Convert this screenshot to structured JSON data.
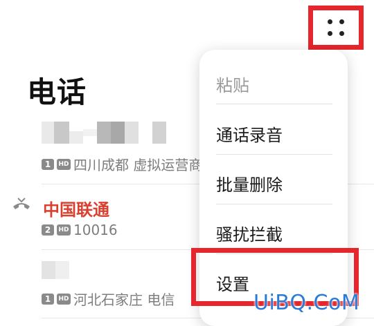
{
  "page": {
    "title": "电话"
  },
  "more_button": {
    "icon": "more-dots-icon"
  },
  "calls": [
    {
      "sim": "1",
      "hd": "HD",
      "location": "四川成都 虚拟运营商",
      "name_obscured": true
    },
    {
      "name": "中国联通",
      "sim": "2",
      "hd": "HD",
      "number": "10016",
      "status_icon": "missed-call-icon",
      "name_color": "#d8402f"
    },
    {
      "sim": "1",
      "hd": "HD",
      "location": "河北石家庄 电信",
      "name_obscured": true
    }
  ],
  "menu": {
    "items": [
      {
        "label": "粘贴",
        "enabled": false
      },
      {
        "label": "通话录音",
        "enabled": true
      },
      {
        "label": "批量删除",
        "enabled": true
      },
      {
        "label": "骚扰拦截",
        "enabled": true
      },
      {
        "label": "设置",
        "enabled": true
      }
    ]
  },
  "watermark": "UiBQ.CoM",
  "colors": {
    "highlight": "#e5262c",
    "missed": "#d8402f",
    "watermark": "#2a7bd8"
  }
}
